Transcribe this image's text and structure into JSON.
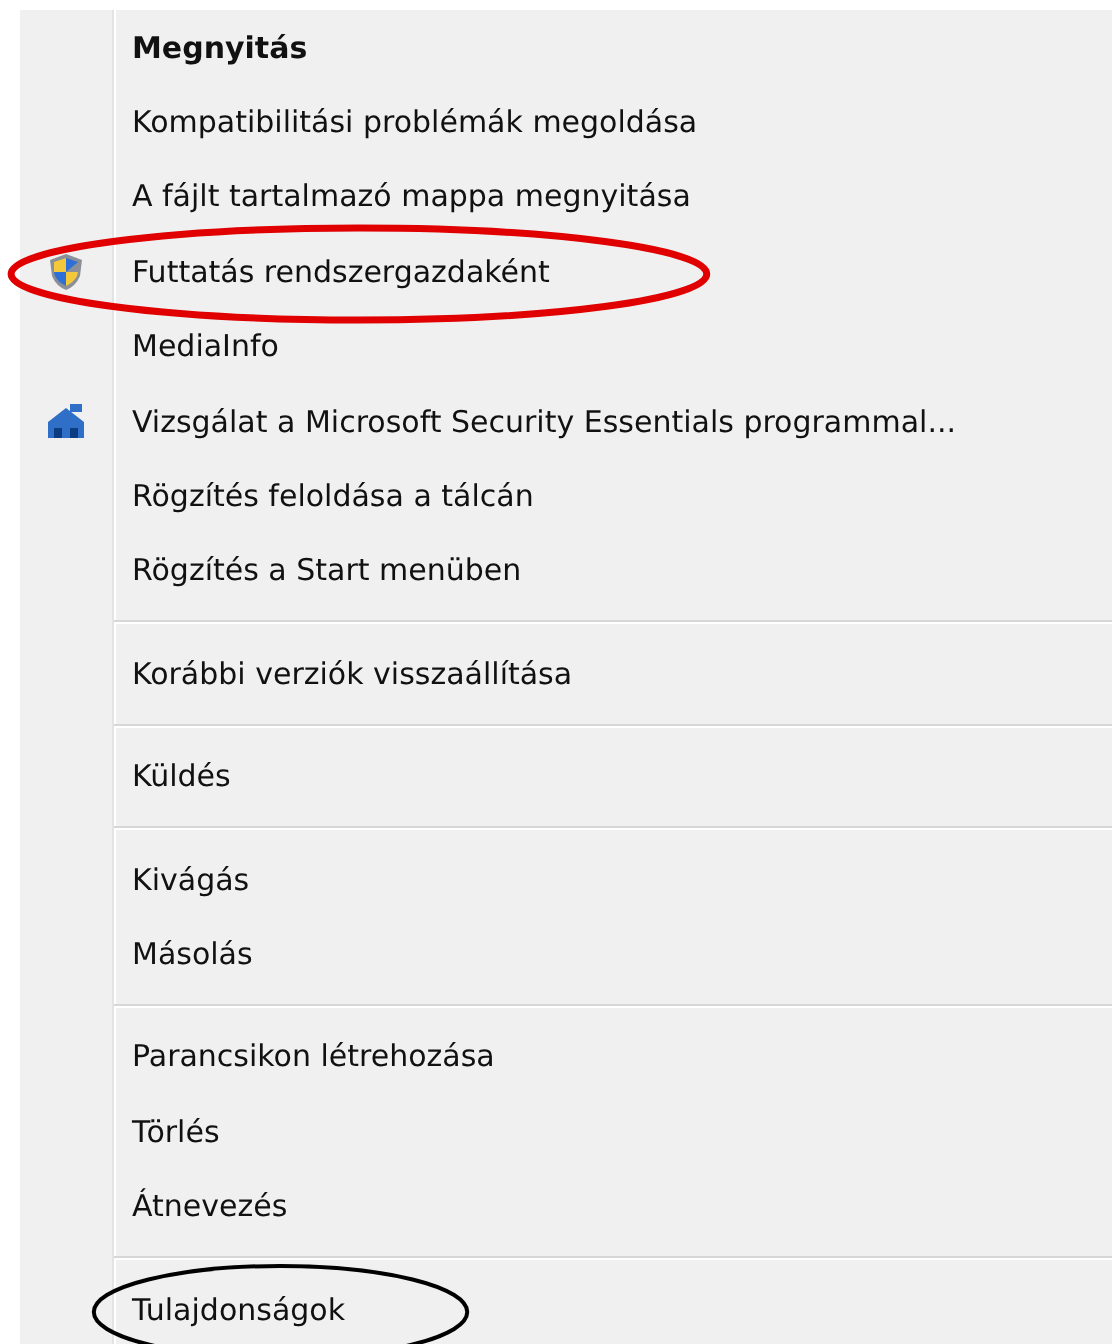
{
  "menu": {
    "groups": [
      {
        "items": [
          {
            "label": "Megnyitás",
            "default": true
          },
          {
            "label": "Kompatibilitási problémák megoldása",
            "default": false
          },
          {
            "label": "A fájlt tartalmazó mappa megnyitása",
            "default": false
          },
          {
            "label": "Futtatás rendszergazdaként",
            "default": false,
            "kind": "shield",
            "circled": true,
            "color": "#e00000"
          },
          {
            "label": "MediaInfo",
            "default": false
          },
          {
            "label": "Vizsgálat a Microsoft Security Essentials programmal...",
            "default": false,
            "kind": "house"
          },
          {
            "label": "Rögzítés feloldása a tálcán",
            "default": false
          },
          {
            "label": "Rögzítés a Start menüben",
            "default": false
          }
        ]
      },
      {
        "items": [
          {
            "label": "Korábbi verziók visszaállítása",
            "default": false
          }
        ]
      },
      {
        "items": [
          {
            "label": "Küldés",
            "default": false
          }
        ]
      },
      {
        "items": [
          {
            "label": "Kivágás",
            "default": false
          },
          {
            "label": "Másolás",
            "default": false
          }
        ]
      },
      {
        "items": [
          {
            "label": "Parancsikon létrehozása",
            "default": false
          },
          {
            "label": "Törlés",
            "default": false
          },
          {
            "label": "Átnevezés",
            "default": false
          }
        ]
      },
      {
        "items": [
          {
            "label": "Tulajdonságok",
            "default": false,
            "circled": true,
            "color": "#000000"
          }
        ]
      }
    ]
  }
}
